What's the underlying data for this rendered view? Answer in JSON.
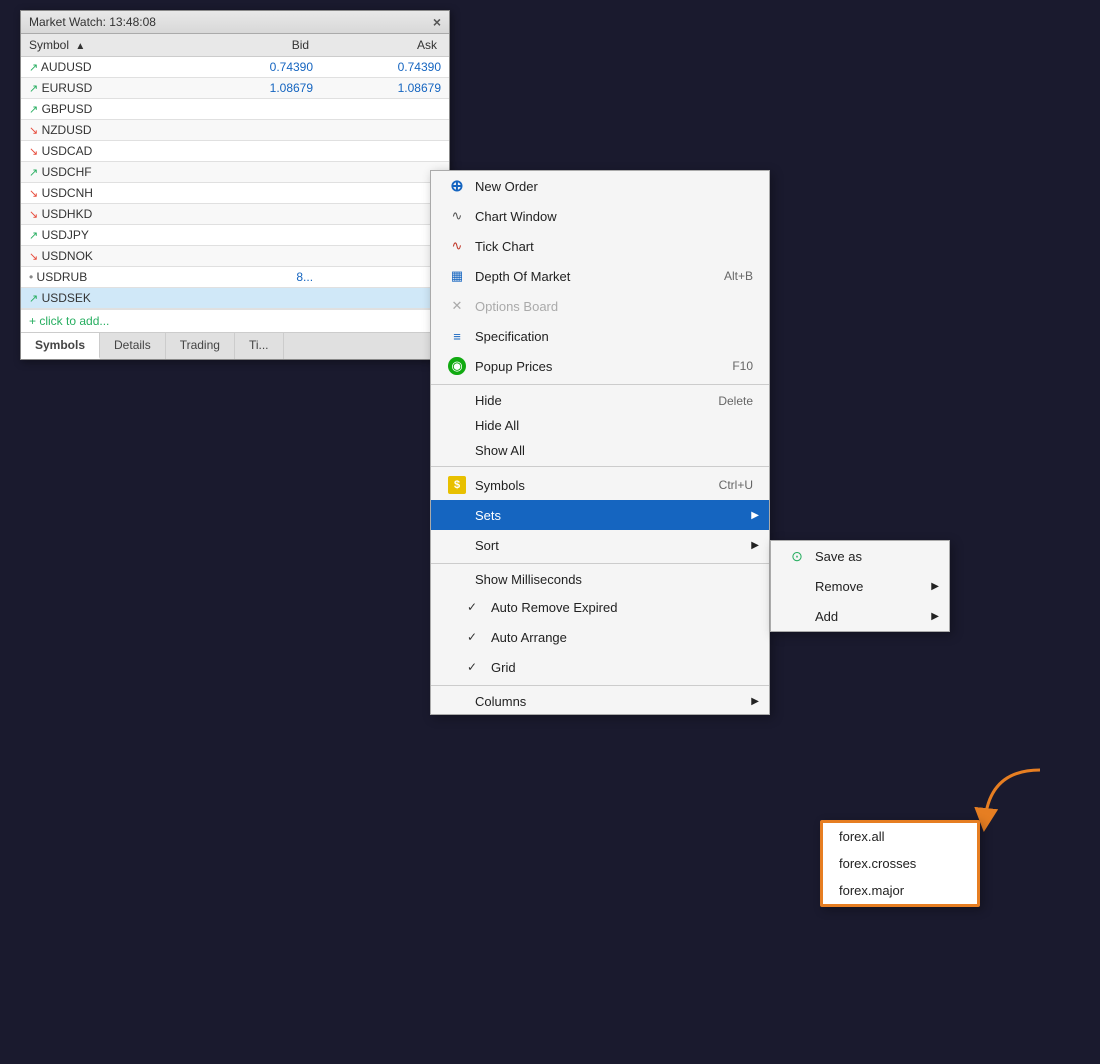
{
  "window": {
    "title": "Market Watch:  13:48:08",
    "close_btn": "×"
  },
  "table": {
    "headers": {
      "symbol": "Symbol",
      "bid": "Bid",
      "ask": "Ask",
      "sort_indicator": "▲"
    },
    "rows": [
      {
        "arrow": "↗",
        "arrow_type": "up",
        "symbol": "AUDUSD",
        "bid": "0.74390",
        "ask": "0.74390"
      },
      {
        "arrow": "↗",
        "arrow_type": "up",
        "symbol": "EURUSD",
        "bid": "1.08679",
        "ask": "1.08679"
      },
      {
        "arrow": "↗",
        "arrow_type": "up",
        "symbol": "GBPUSD",
        "bid": "",
        "ask": ""
      },
      {
        "arrow": "↘",
        "arrow_type": "down",
        "symbol": "NZDUSD",
        "bid": "",
        "ask": ""
      },
      {
        "arrow": "↘",
        "arrow_type": "down",
        "symbol": "USDCAD",
        "bid": "",
        "ask": ""
      },
      {
        "arrow": "↗",
        "arrow_type": "up",
        "symbol": "USDCHF",
        "bid": "",
        "ask": ""
      },
      {
        "arrow": "↘",
        "arrow_type": "down",
        "symbol": "USDCNH",
        "bid": "",
        "ask": ""
      },
      {
        "arrow": "↘",
        "arrow_type": "down",
        "symbol": "USDHKD",
        "bid": "",
        "ask": ""
      },
      {
        "arrow": "↗",
        "arrow_type": "up",
        "symbol": "USDJPY",
        "bid": "",
        "ask": ""
      },
      {
        "arrow": "↘",
        "arrow_type": "down",
        "symbol": "USDNOK",
        "bid": "",
        "ask": ""
      },
      {
        "arrow": "•",
        "arrow_type": "dot",
        "symbol": "USDRUB",
        "bid": "8...",
        "ask": ""
      },
      {
        "arrow": "↗",
        "arrow_type": "up",
        "symbol": "USDSEK",
        "bid": "",
        "ask": "",
        "selected": true
      }
    ],
    "click_to_add": "+ click to add..."
  },
  "tabs": [
    {
      "label": "Symbols",
      "active": true
    },
    {
      "label": "Details"
    },
    {
      "label": "Trading"
    },
    {
      "label": "Ti..."
    }
  ],
  "context_menu": {
    "items": [
      {
        "id": "new-order",
        "icon": "⊕",
        "icon_type": "new-order",
        "label": "New Order",
        "shortcut": "",
        "separator_after": false
      },
      {
        "id": "chart-window",
        "icon": "∿",
        "icon_type": "chart",
        "label": "Chart Window",
        "shortcut": "",
        "separator_after": false
      },
      {
        "id": "tick-chart",
        "icon": "∿",
        "icon_type": "tick",
        "label": "Tick Chart",
        "shortcut": "",
        "separator_after": false
      },
      {
        "id": "depth-of-market",
        "icon": "≡",
        "icon_type": "depth",
        "label": "Depth Of Market",
        "shortcut": "Alt+B",
        "separator_after": false
      },
      {
        "id": "options-board",
        "icon": "✕",
        "icon_type": "options",
        "label": "Options Board",
        "shortcut": "",
        "disabled": true,
        "separator_after": false
      },
      {
        "id": "specification",
        "icon": "≡",
        "icon_type": "spec",
        "label": "Specification",
        "shortcut": "",
        "separator_after": false
      },
      {
        "id": "popup-prices",
        "icon": "◉",
        "icon_type": "popup",
        "label": "Popup Prices",
        "shortcut": "F10",
        "separator_after": true
      },
      {
        "id": "hide",
        "icon": "",
        "label": "Hide",
        "shortcut": "Delete",
        "separator_after": false,
        "no_icon": true
      },
      {
        "id": "hide-all",
        "icon": "",
        "label": "Hide All",
        "shortcut": "",
        "separator_after": false,
        "no_icon": true
      },
      {
        "id": "show-all",
        "icon": "",
        "label": "Show All",
        "shortcut": "",
        "separator_after": true,
        "no_icon": true
      },
      {
        "id": "symbols",
        "icon": "$",
        "icon_type": "dollar",
        "label": "Symbols",
        "shortcut": "Ctrl+U",
        "separator_after": false
      },
      {
        "id": "sets",
        "icon": "",
        "label": "Sets",
        "shortcut": "",
        "has_submenu": true,
        "highlighted": true,
        "separator_after": false
      },
      {
        "id": "sort",
        "icon": "",
        "label": "Sort",
        "shortcut": "",
        "has_submenu": true,
        "separator_after": true
      },
      {
        "id": "show-milliseconds",
        "icon": "",
        "label": "Show Milliseconds",
        "shortcut": "",
        "separator_after": false,
        "no_icon": true
      },
      {
        "id": "auto-remove",
        "icon": "",
        "label": "Auto Remove Expired",
        "shortcut": "",
        "checked": true,
        "separator_after": false
      },
      {
        "id": "auto-arrange",
        "icon": "",
        "label": "Auto Arrange",
        "shortcut": "",
        "checked": true,
        "separator_after": false
      },
      {
        "id": "grid",
        "icon": "",
        "label": "Grid",
        "shortcut": "",
        "checked": true,
        "separator_after": true
      },
      {
        "id": "columns",
        "icon": "",
        "label": "Columns",
        "shortcut": "",
        "has_submenu": true,
        "no_icon": true
      }
    ]
  },
  "sets_submenu": {
    "items": [
      {
        "id": "save-as",
        "icon": "⊙",
        "label": "Save as",
        "separator_after": false
      },
      {
        "id": "remove",
        "icon": "",
        "label": "Remove",
        "has_submenu": true,
        "separator_after": false
      },
      {
        "id": "add",
        "icon": "",
        "label": "Add",
        "has_submenu": true,
        "separator_after": false
      }
    ]
  },
  "forex_submenu": {
    "items": [
      {
        "id": "forex-all",
        "label": "forex.all"
      },
      {
        "id": "forex-crosses",
        "label": "forex.crosses"
      },
      {
        "id": "forex-major",
        "label": "forex.major"
      }
    ]
  }
}
